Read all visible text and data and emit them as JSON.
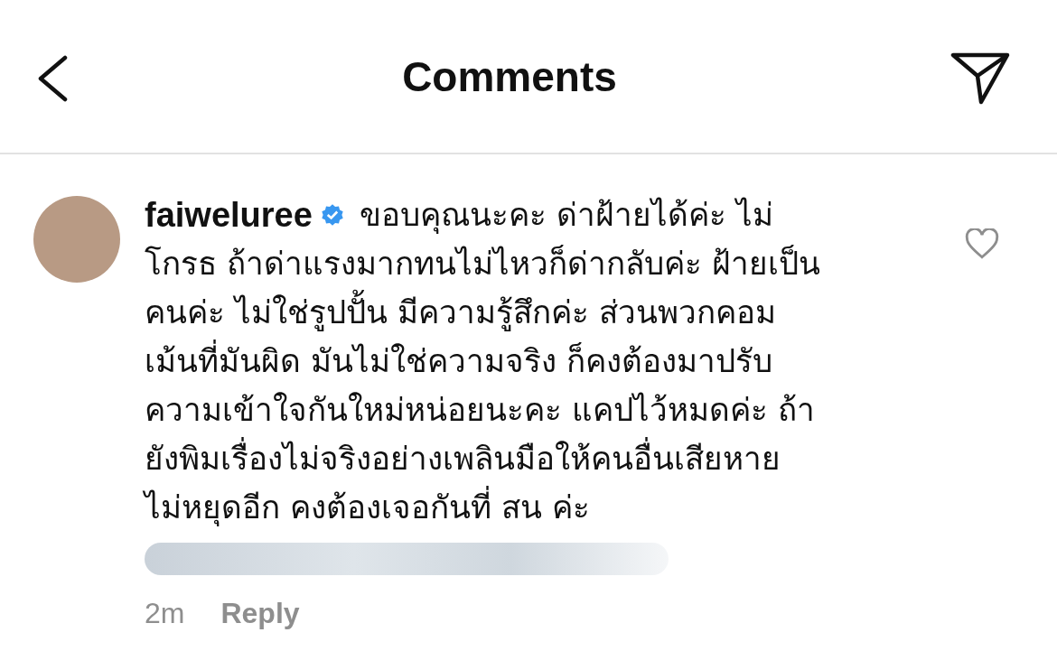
{
  "header": {
    "title": "Comments"
  },
  "comment": {
    "username": "faiweluree",
    "verified": true,
    "liked": false,
    "lines": [
      "ขอบคุณนะคะ ด่าฝ้ายได้ค่ะ ไม่",
      "โกรธ ถ้าด่าแรงมากทนไม่ไหวก็ด่ากลับค่ะ ฝ้ายเป็น",
      "คนค่ะ ไม่ใช่รูปปั้น มีความรู้สึกค่ะ ส่วนพวกคอม",
      "เม้นที่มันผิด มันไม่ใช่ความจริง ก็คงต้องมาปรับ",
      "ความเข้าใจกันใหม่หน่อยนะคะ แคปไว้หมดค่ะ ถ้า",
      "ยังพิมเรื่องไม่จริงอย่างเพลินมือให้คนอื่นเสียหาย",
      "ไม่หยุดอีก คงต้องเจอกันที่ สน ค่ะ"
    ],
    "time": "2m",
    "reply": "Reply"
  }
}
